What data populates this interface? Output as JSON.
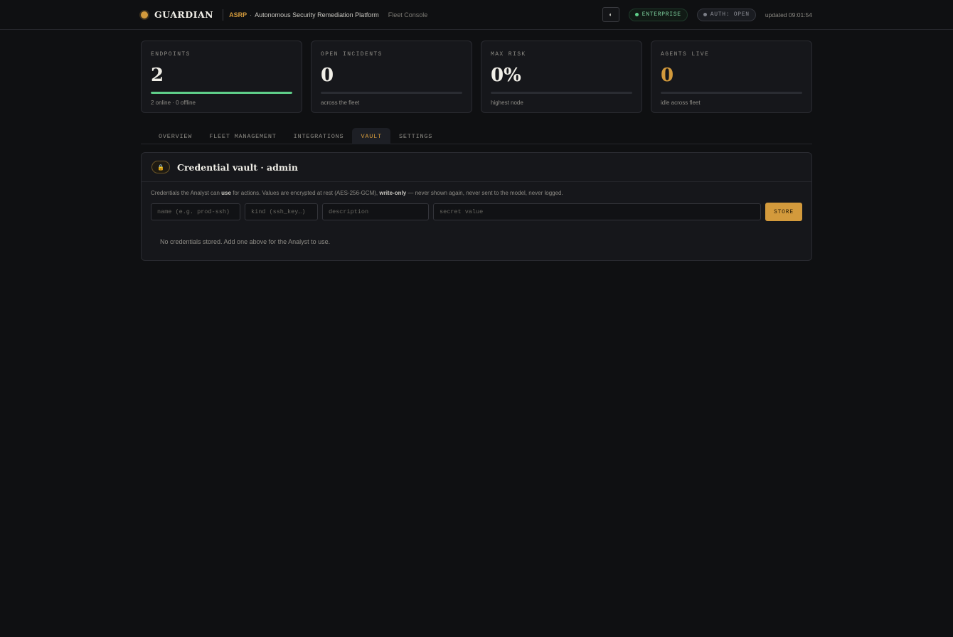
{
  "header": {
    "brand": "GUARDIAN",
    "product_short": "ASRP",
    "separator": "·",
    "product_full": "Autonomous Security Remediation Platform",
    "section": "Fleet Console",
    "theme_toggle_icon": "◐",
    "edition_badge": "ENTERPRISE",
    "auth_badge": "AUTH: OPEN",
    "updated": "updated 09:01:54"
  },
  "stats": [
    {
      "label": "ENDPOINTS",
      "value": "2",
      "sub": "2 online · 0 offline",
      "progress": 1.0
    },
    {
      "label": "OPEN INCIDENTS",
      "value": "0",
      "sub": "across the fleet",
      "progress": 0
    },
    {
      "label": "MAX RISK",
      "value": "0%",
      "sub": "highest node",
      "progress": 0
    },
    {
      "label": "AGENTS LIVE",
      "value": "0",
      "sub": "idle across fleet",
      "progress": 0
    }
  ],
  "tabs": [
    {
      "label": "OVERVIEW",
      "active": false
    },
    {
      "label": "FLEET MANAGEMENT",
      "active": false
    },
    {
      "label": "INTEGRATIONS",
      "active": false
    },
    {
      "label": "VAULT",
      "active": true
    },
    {
      "label": "SETTINGS",
      "active": false
    }
  ],
  "vault": {
    "lock_icon": "🔒",
    "title": "Credential vault · admin",
    "desc_1": "Credentials the Analyst can ",
    "desc_use": "use",
    "desc_2": " for actions. Values are encrypted at rest (AES-256-GCM), ",
    "desc_write_only": "write-only",
    "desc_3": " — never shown again, never sent to the model, never logged.",
    "form": {
      "name_placeholder": "name (e.g. prod-ssh)",
      "name_value": "",
      "kind_placeholder": "kind (ssh_key…)",
      "kind_value": "",
      "description_placeholder": "description",
      "description_value": "",
      "secret_placeholder": "secret value",
      "secret_value": "",
      "store_label": "STORE"
    },
    "empty_message": "No credentials stored. Add one above for the Analyst to use."
  },
  "colors": {
    "accent": "#d39a3c",
    "success": "#5fcf8a",
    "background": "#0f1012",
    "card": "#16171b"
  }
}
